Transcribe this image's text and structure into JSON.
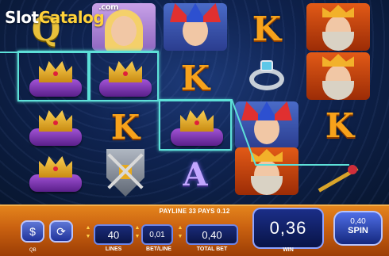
{
  "watermark": {
    "slot": "Slot",
    "catalog": "Catalog",
    "dotcom": ".com"
  },
  "grid": {
    "columns": 5,
    "rows": 4,
    "symbols": [
      [
        "Q",
        "princess",
        "jester",
        "K",
        "king"
      ],
      [
        "crown",
        "crown",
        "K",
        "ring",
        "king"
      ],
      [
        "crown",
        "K",
        "crown",
        "jester",
        "K"
      ],
      [
        "crown",
        "shield",
        "A",
        "king",
        "scepter"
      ]
    ],
    "highlighted": [
      "r1c0",
      "r1c1",
      "r2c2"
    ]
  },
  "win_line": {
    "payline_text": "PAYLINE 33 PAYS 0.12",
    "color": "#5de0d8"
  },
  "controls": {
    "lines": {
      "value": "40",
      "label": "LINES"
    },
    "bet_per_line": {
      "value": "0,01",
      "label": "BET/LINE"
    },
    "total_bet": {
      "value": "0,40",
      "label": "TOTAL BET"
    },
    "win": {
      "value": "0,36",
      "label": "WIN"
    },
    "spin": {
      "value": "0,40",
      "label": "SPIN"
    },
    "qb": "QB"
  },
  "colors": {
    "bar": "#c86010",
    "field": "#0b1648",
    "highlight": "#5de0d8"
  }
}
